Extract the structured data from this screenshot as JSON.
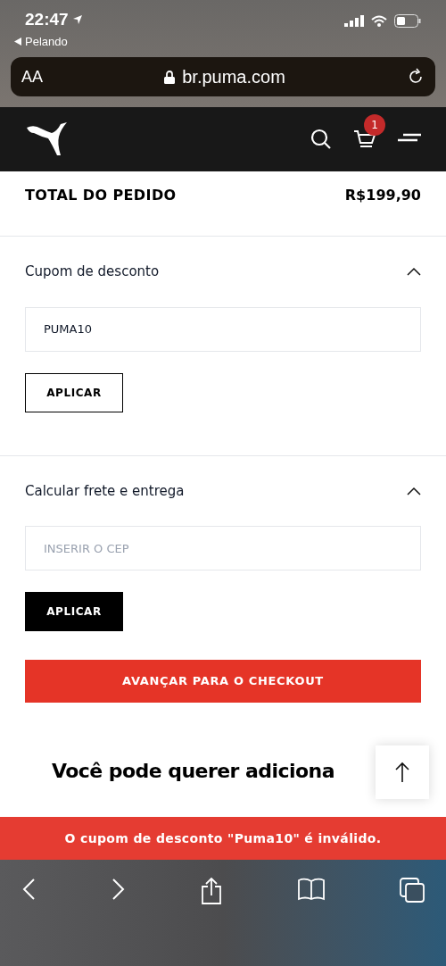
{
  "status_bar": {
    "time": "22:47",
    "back_app": "Pelando"
  },
  "address_bar": {
    "text_size": "AA",
    "url": "br.puma.com"
  },
  "header": {
    "cart_count": "1"
  },
  "order_total": {
    "label": "TOTAL DO PEDIDO",
    "value": "R$199,90"
  },
  "sections": [
    {
      "title": "Cupom de desconto",
      "expanded": true,
      "field": {
        "value": "PUMA10"
      },
      "button": {
        "label": "APLICAR",
        "kind": "outline"
      }
    },
    {
      "title": "Calcular frete e entrega",
      "expanded": true,
      "field": {
        "placeholder": "INSERIR O CEP"
      },
      "button": {
        "label": "APLICAR",
        "kind": "solid"
      }
    }
  ],
  "checkout_button": "AVANÇAR PARA O CHECKOUT",
  "recommendations_heading": "Você pode querer adiciona",
  "toast": "O cupom de desconto \"Puma10\" é inválido."
}
